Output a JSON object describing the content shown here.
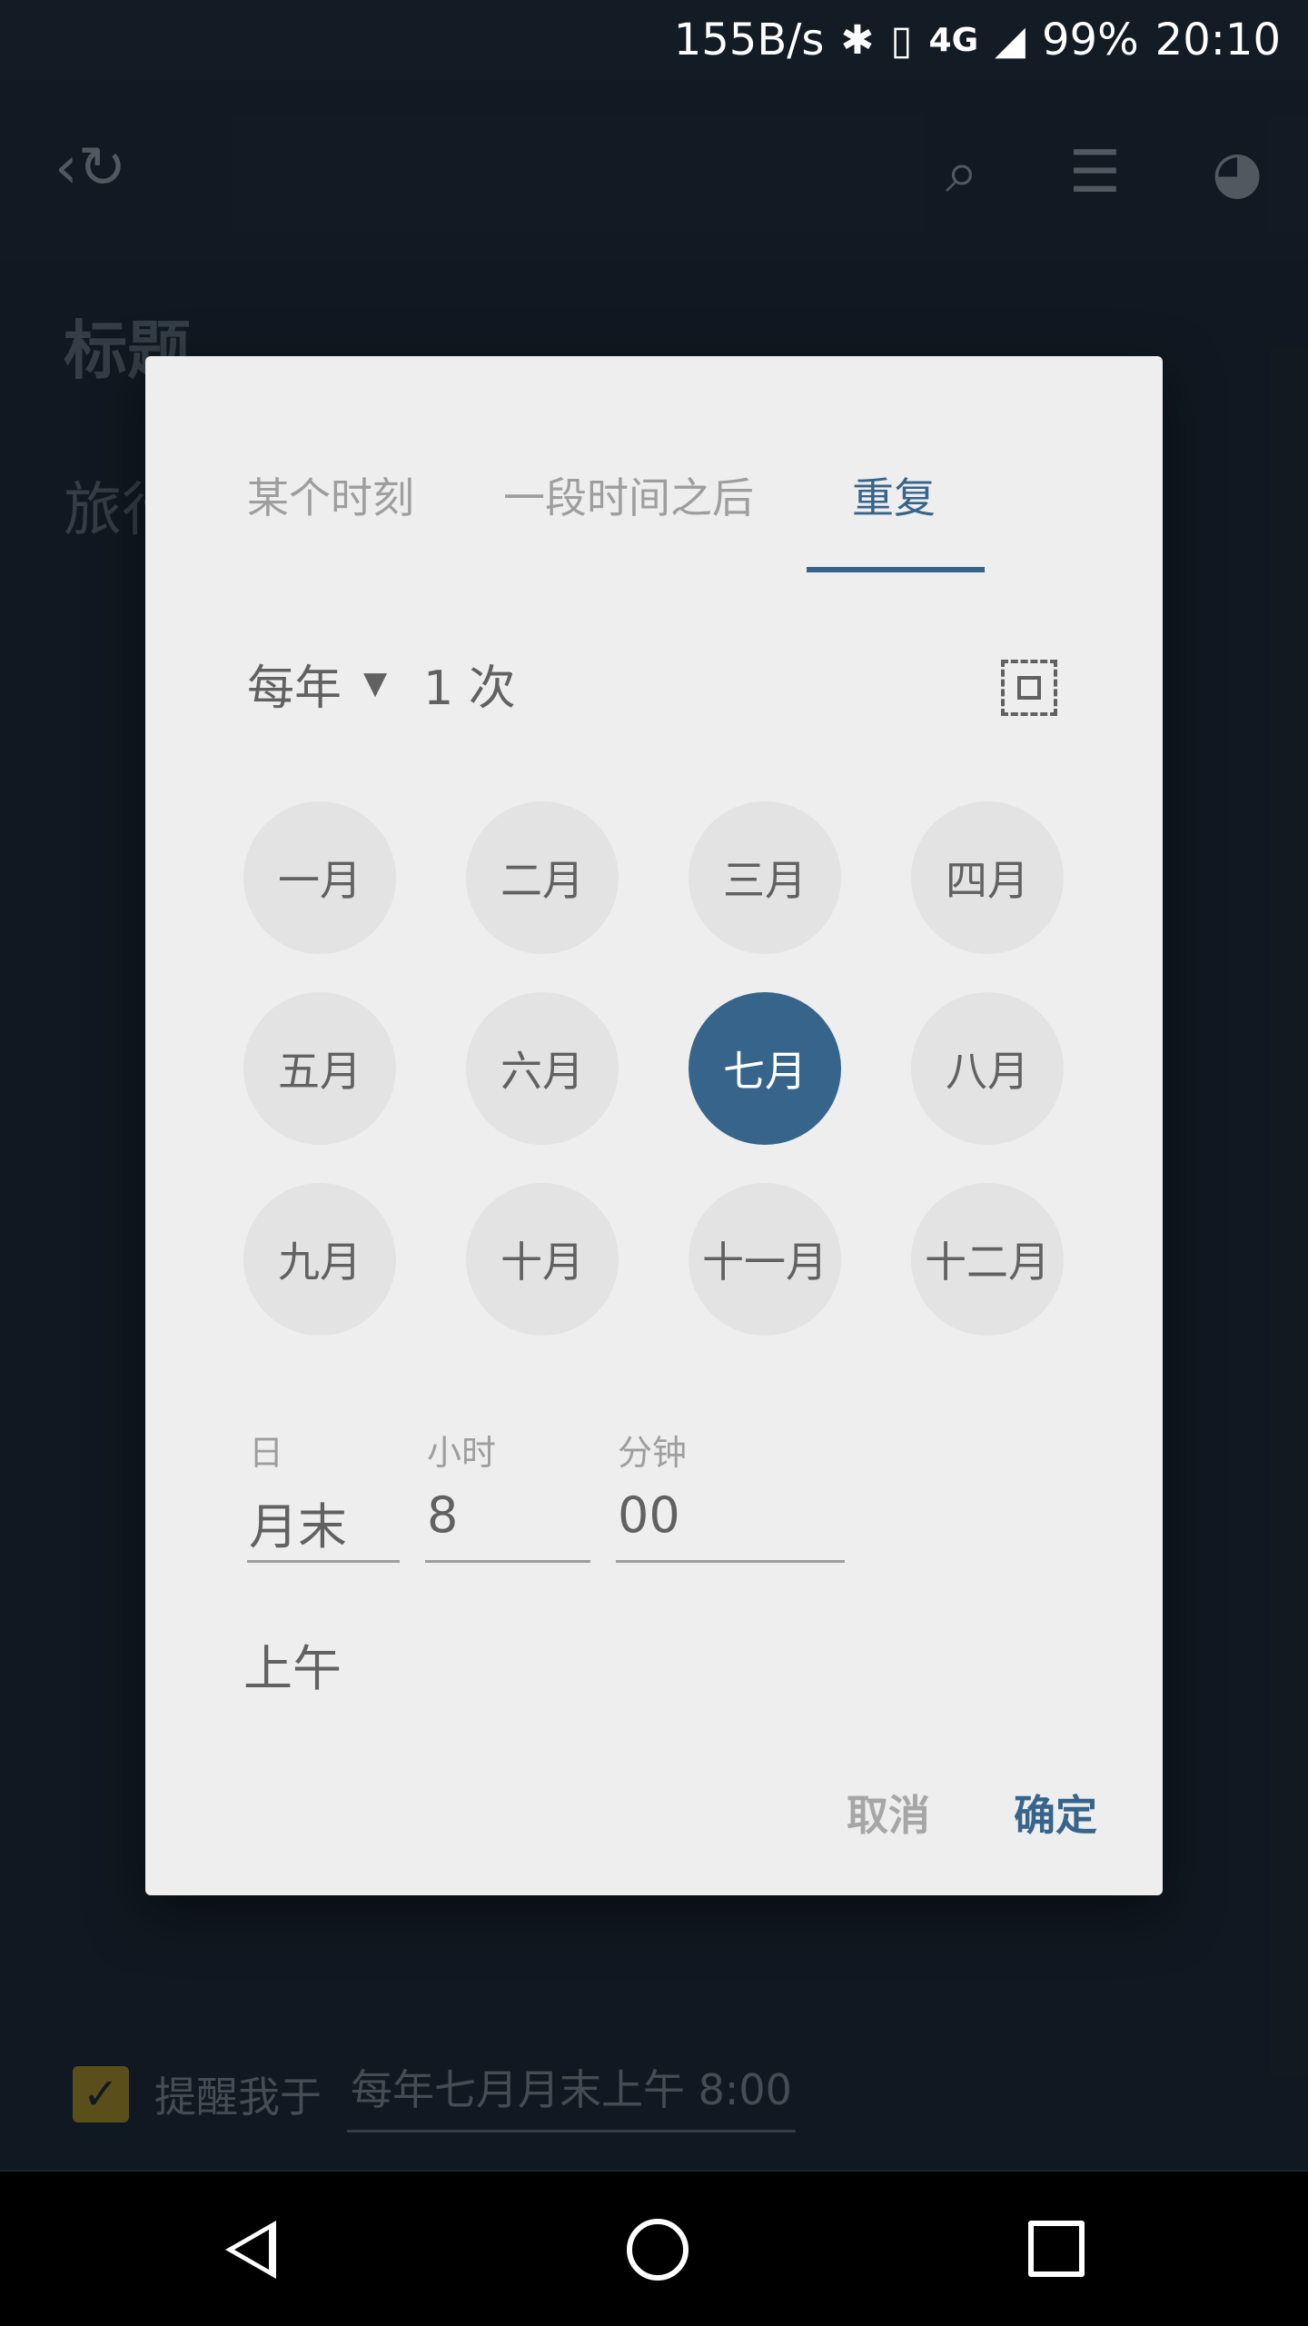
{
  "status_bar": {
    "speed": "155B/s",
    "network": "4G",
    "battery": "99%",
    "time": "20:10"
  },
  "app": {
    "title": "标题",
    "body_preview": "旅行",
    "reminder_label": "提醒我于",
    "reminder_value": "每年七月月末上午 8:00"
  },
  "dialog": {
    "tabs": [
      "某个时刻",
      "一段时间之后",
      "重复"
    ],
    "active_tab": 2,
    "frequency": "每年",
    "count": "1 次",
    "months": [
      "一月",
      "二月",
      "三月",
      "四月",
      "五月",
      "六月",
      "七月",
      "八月",
      "九月",
      "十月",
      "十一月",
      "十二月"
    ],
    "selected_month_index": 6,
    "fields": {
      "day_label": "日",
      "day_value": "月末",
      "hour_label": "小时",
      "hour_value": "8",
      "minute_label": "分钟",
      "minute_value": "00"
    },
    "ampm": "上午",
    "cancel": "取消",
    "ok": "确定"
  },
  "colors": {
    "accent": "#36648b",
    "dialog_bg": "#eeeeee",
    "page_bg": "#1a2733"
  }
}
